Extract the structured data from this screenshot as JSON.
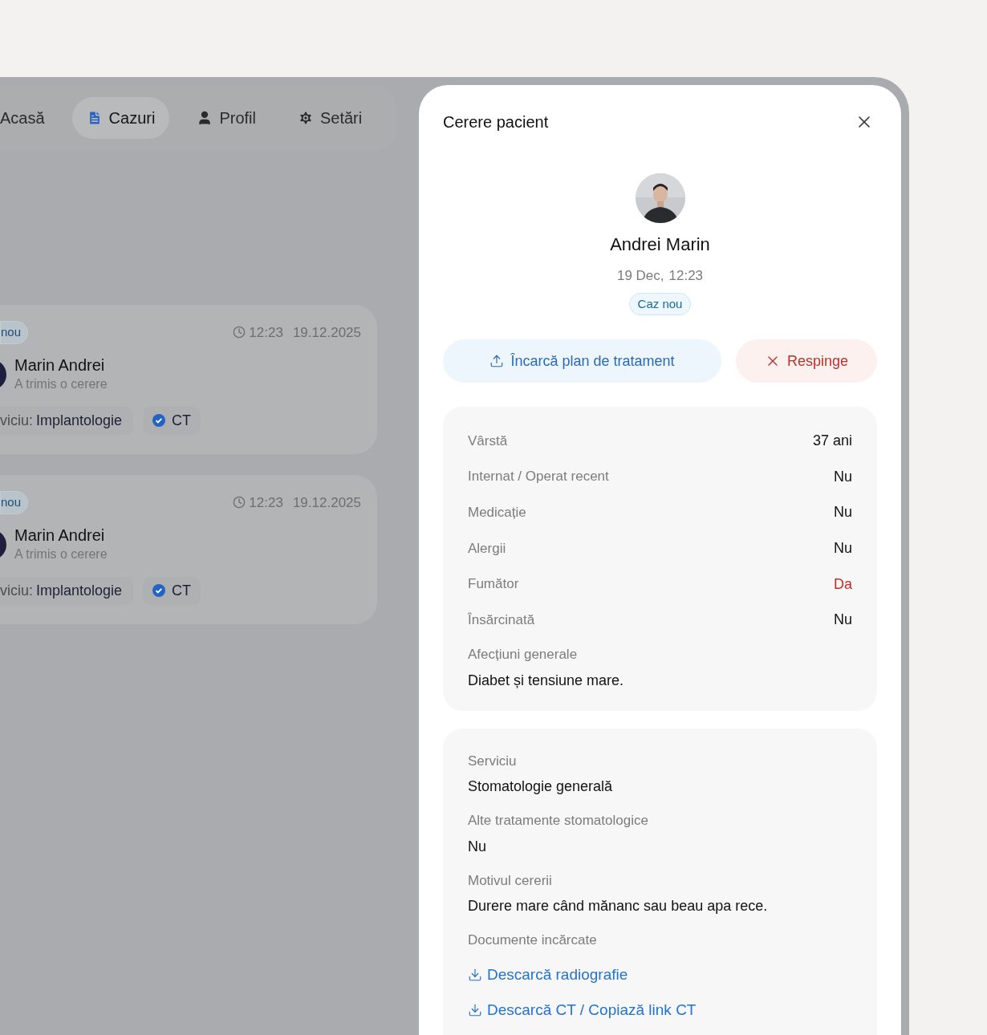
{
  "nav": {
    "tabs": [
      {
        "label": "Acasă",
        "selected": false
      },
      {
        "label": "Cazuri",
        "selected": true
      },
      {
        "label": "Profil",
        "selected": false
      },
      {
        "label": "Setări",
        "selected": false
      }
    ]
  },
  "cards": [
    {
      "badge": "nou",
      "time": "12:23",
      "date": "19.12.2025",
      "name": "Marin Andrei",
      "subtitle": "A trimis o cerere",
      "service_label": "viciu:",
      "service": "Implantologie",
      "document": "CT"
    },
    {
      "badge": "nou",
      "time": "12:23",
      "date": "19.12.2025",
      "name": "Marin Andrei",
      "subtitle": "A trimis o cerere",
      "service_label": "viciu:",
      "service": "Implantologie",
      "document": "CT"
    }
  ],
  "modal": {
    "title": "Cerere pacient",
    "patient": {
      "name": "Andrei Marin",
      "date": "19 Dec,",
      "time": "12:23",
      "badge": "Caz nou"
    },
    "actions": [
      {
        "label": "Încarcă plan de tratament",
        "kind": "primary"
      },
      {
        "label": "Respinge",
        "kind": "danger"
      }
    ],
    "health": [
      {
        "label": "Vârstă",
        "value": "37 ani",
        "alert": false
      },
      {
        "label": "Internat / Operat recent",
        "value": "Nu",
        "alert": false
      },
      {
        "label": "Medicație",
        "value": "Nu",
        "alert": false
      },
      {
        "label": "Alergii",
        "value": "Nu",
        "alert": false
      },
      {
        "label": "Fumător",
        "value": "Da",
        "alert": true
      },
      {
        "label": "Însărcinată",
        "value": "Nu",
        "alert": false
      }
    ],
    "general": {
      "label": "Afecțiuni generale",
      "value": "Diabet și tensiune mare."
    },
    "request": [
      {
        "label": "Serviciu",
        "value": "Stomatologie generală"
      },
      {
        "label": "Alte tratamente stomatologice",
        "value": "Nu"
      },
      {
        "label": "Motivul cererii",
        "value": "Durere mare când mănanc sau beau apa rece."
      }
    ],
    "documents": {
      "label": "Documente incărcate",
      "links": [
        "Descarcă radiografie",
        "Descarcă CT / Copiază link CT"
      ]
    }
  }
}
